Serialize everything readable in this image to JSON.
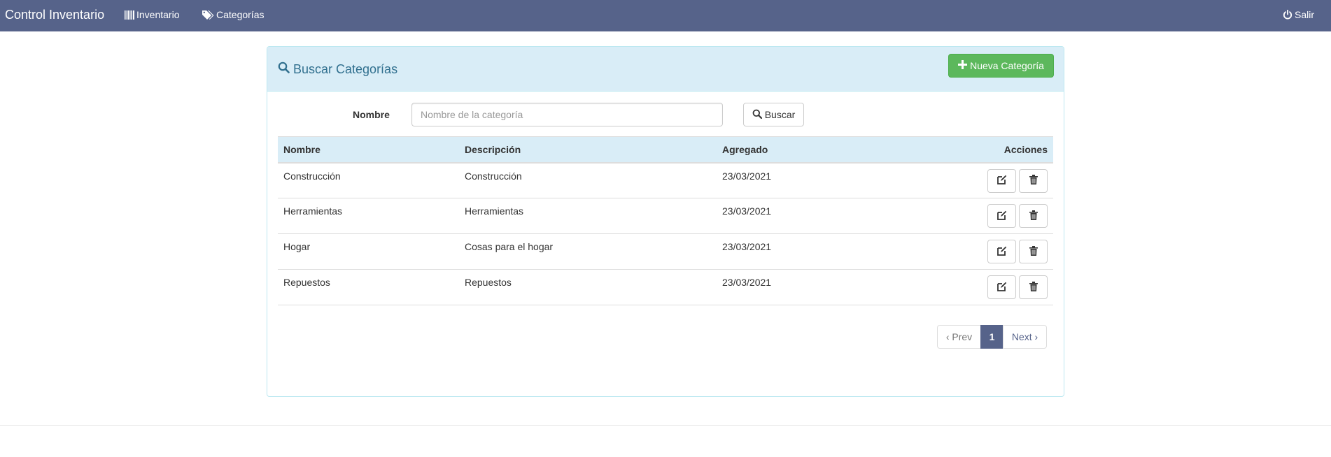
{
  "navbar": {
    "brand": "Control Inventario",
    "links": [
      {
        "label": "Inventario",
        "icon": "barcode-icon"
      },
      {
        "label": "Categorías",
        "icon": "tags-icon"
      }
    ],
    "logout_label": "Salir",
    "logout_icon": "power-icon",
    "bg_color": "#56638a"
  },
  "panel": {
    "title": "Buscar Categorías",
    "new_button_label": "Nueva Categoría",
    "heading_color": "#d9edf7",
    "title_color": "#31708f"
  },
  "search": {
    "label": "Nombre",
    "placeholder": "Nombre de la categoría",
    "value": "",
    "button_label": "Buscar"
  },
  "table": {
    "headers": [
      "Nombre",
      "Descripción",
      "Agregado",
      "Acciones"
    ],
    "rows": [
      {
        "nombre": "Construcción",
        "descripcion": "Construcción",
        "agregado": "23/03/2021"
      },
      {
        "nombre": "Herramientas",
        "descripcion": "Herramientas",
        "agregado": "23/03/2021"
      },
      {
        "nombre": "Hogar",
        "descripcion": "Cosas para el hogar",
        "agregado": "23/03/2021"
      },
      {
        "nombre": "Repuestos",
        "descripcion": "Repuestos",
        "agregado": "23/03/2021"
      }
    ],
    "row_actions": [
      {
        "icon": "edit-icon"
      },
      {
        "icon": "trash-icon"
      }
    ]
  },
  "pagination": {
    "prev_label": "‹ Prev",
    "current_page": "1",
    "next_label": "Next ›",
    "active_color": "#56638a"
  }
}
